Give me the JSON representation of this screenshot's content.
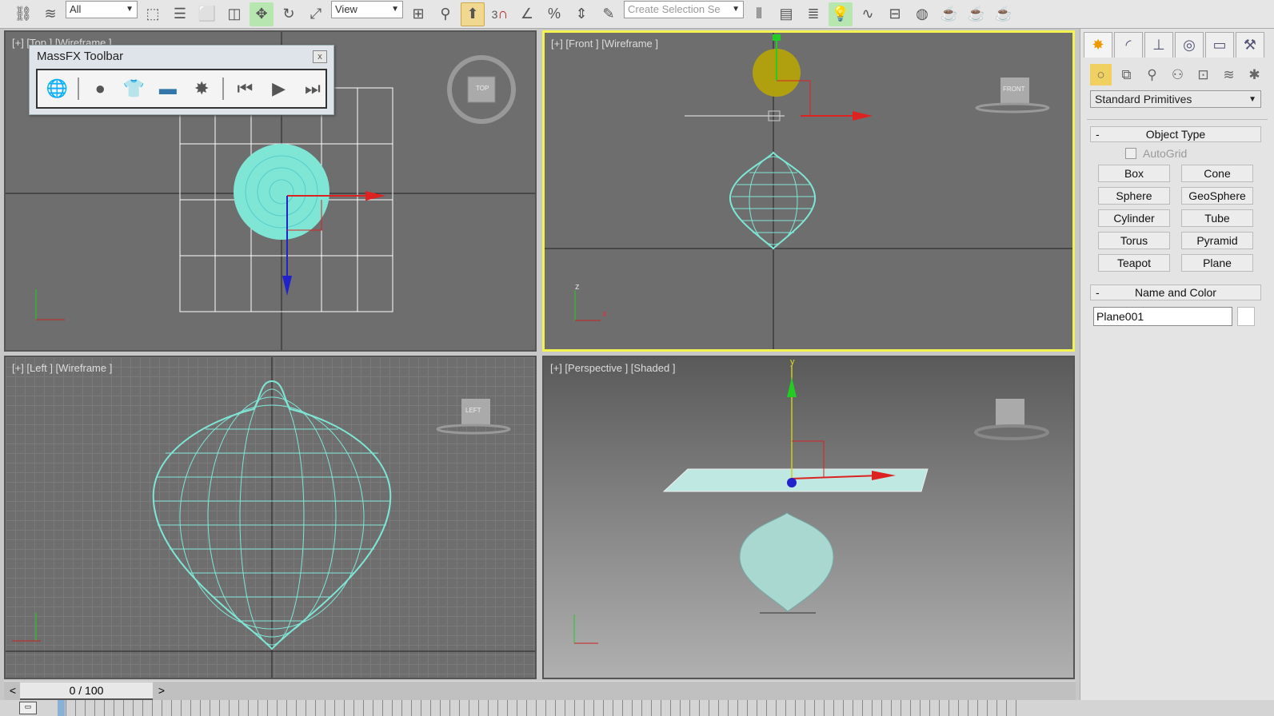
{
  "toolbar": {
    "selection_filter": "All",
    "ref_coord": "View",
    "named_selection_placeholder": "Create Selection Se",
    "snap_label": "3"
  },
  "viewports": {
    "top": "[+] [Top ] [Wireframe ]",
    "front": "[+] [Front ] [Wireframe ]",
    "left": "[+] [Left ] [Wireframe ]",
    "perspective": "[+] [Perspective ] [Shaded ]",
    "viewcube_top": "TOP",
    "viewcube_front": "FRONT",
    "viewcube_left": "LEFT",
    "axis_x": "x",
    "axis_y": "y",
    "axis_z": "z"
  },
  "massfx": {
    "title": "MassFX Toolbar",
    "close": "x"
  },
  "command_panel": {
    "category": "Standard Primitives",
    "object_type": {
      "header": "Object Type",
      "collapse": "-",
      "autogrid": "AutoGrid",
      "buttons": [
        "Box",
        "Cone",
        "Sphere",
        "GeoSphere",
        "Cylinder",
        "Tube",
        "Torus",
        "Pyramid",
        "Teapot",
        "Plane"
      ]
    },
    "name_and_color": {
      "header": "Name and Color",
      "collapse": "-",
      "name_value": "Plane001"
    }
  },
  "time_slider": {
    "prev": "<",
    "next": ">",
    "frame": "0 / 100",
    "current_frame": 0,
    "total_frames": 100
  },
  "colors": {
    "viewport_bg": "#6e6e6e",
    "wire": "#7fe6d6",
    "active_border": "#f2f250"
  }
}
